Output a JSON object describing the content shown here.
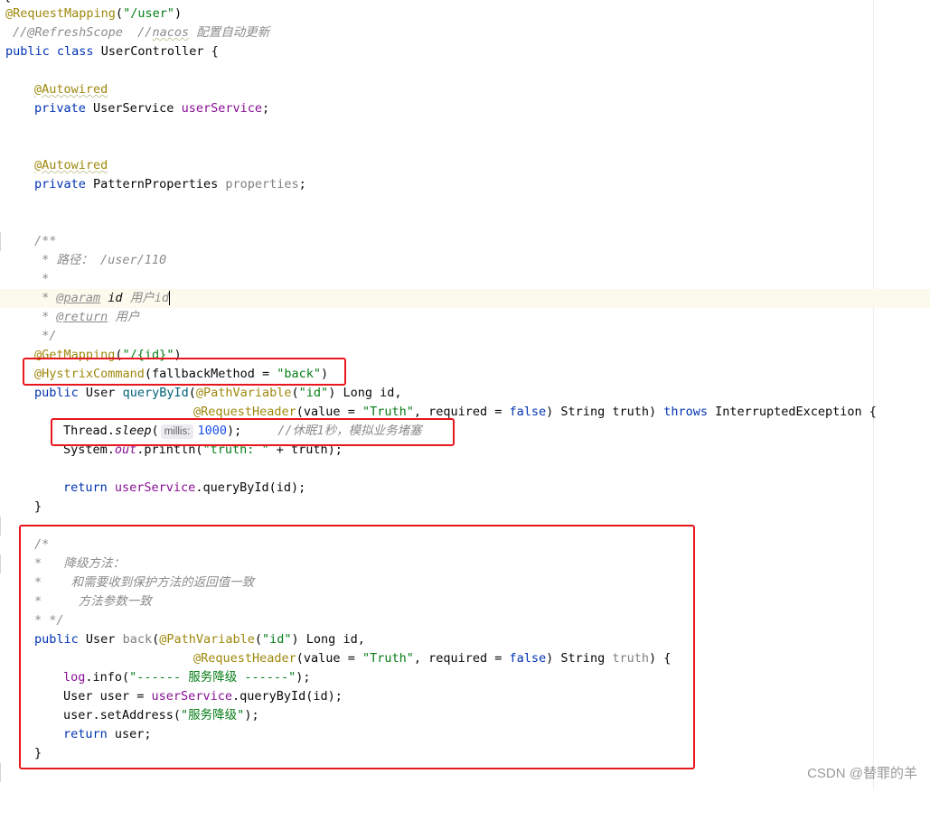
{
  "editor": {
    "top_fragment": "{",
    "lines": {
      "l1": {
        "ann": "@RequestMapping",
        "open": "(",
        "str": "\"/user\"",
        "close": ")"
      },
      "l2": {
        "c1": "//@RefreshScope",
        "c2": "  //",
        "c3": "nacos",
        "c4": " 配置自动更新"
      },
      "l3": {
        "k1": "public",
        "k2": "class",
        "name": "UserController",
        "brace": " {"
      },
      "l5": {
        "ann": "@Autowired"
      },
      "l6": {
        "k": "private",
        "type": " UserService ",
        "field": "userService",
        "end": ";"
      },
      "l9": {
        "ann": "@Autowired"
      },
      "l10": {
        "k": "private",
        "type": " PatternProperties ",
        "field": "properties",
        "end": ";"
      },
      "l13": {
        "text": "/**"
      },
      "l14": {
        "text": " * 路径： /user/110"
      },
      "l15": {
        "text": " *"
      },
      "l16": {
        "pre": " * ",
        "tag": "@param",
        "mid": " id",
        "desc": " 用户id"
      },
      "l17": {
        "pre": " * ",
        "tag": "@return",
        "desc": " 用户"
      },
      "l18": {
        "text": " */"
      },
      "l19": {
        "ann": "@GetMapping",
        "open": "(",
        "str": "\"/{id}\"",
        "close": ")"
      },
      "l20": {
        "ann": "@HystrixCommand",
        "open": "(fallbackMethod = ",
        "str": "\"back\"",
        "close": ")"
      },
      "l21": {
        "k": "public",
        "type": " User ",
        "fn": "queryById",
        "open": "(",
        "ann": "@PathVariable",
        "p1": "(",
        "str": "\"id\"",
        "p2": ") Long id,"
      },
      "l22": {
        "ann": "@RequestHeader",
        "p1": "(value = ",
        "str": "\"Truth\"",
        "p2": ", required = ",
        "k": "false",
        "p3": ") String truth) ",
        "k2": "throws",
        "p4": " InterruptedException {"
      },
      "l23": {
        "cls": "Thread.",
        "m": "sleep",
        "open": "(",
        "hint": "millis:",
        "num": "1000",
        "close": ");",
        "cmt": "//休眠1秒，模拟业务堵塞"
      },
      "l24": {
        "a": "System.",
        "f": "out",
        "b": ".println(",
        "str": "\"truth: \"",
        "c": " + truth);"
      },
      "l26": {
        "k": "return",
        "field": " userService",
        "rest": ".queryById(id);"
      },
      "l27": {
        "text": "}"
      },
      "l29": {
        "text": "/*"
      },
      "l30": {
        "text": "*   降级方法："
      },
      "l31": {
        "text": "*    和需要收到保护方法的返回值一致"
      },
      "l32": {
        "text": "*     方法参数一致"
      },
      "l33": {
        "text": "* */"
      },
      "l34": {
        "k": "public",
        "type": " User ",
        "name": "back",
        "open": "(",
        "ann": "@PathVariable",
        "p1": "(",
        "str": "\"id\"",
        "p2": ") Long id,"
      },
      "l35": {
        "ann": "@RequestHeader",
        "p1": "(value = ",
        "str": "\"Truth\"",
        "p2": ", required = ",
        "k": "false",
        "p3": ") String ",
        "unused": "truth",
        "p4": ") {"
      },
      "l36": {
        "field": "log",
        "a": ".info(",
        "str": "\"------ 服务降级 ------\"",
        "b": ");"
      },
      "l37": {
        "a": "User user = ",
        "field": "userService",
        "b": ".queryById(id);"
      },
      "l38": {
        "a": "user.setAddress(",
        "str": "\"服务降级\"",
        "b": ");"
      },
      "l39": {
        "k": "return",
        "b": " user;"
      },
      "l40": {
        "text": "}"
      }
    }
  },
  "watermark": "CSDN @替罪的羊",
  "colors": {
    "keyword": "#0033b3",
    "annotation": "#9e880d",
    "string": "#067d17",
    "comment": "#8c8c8c",
    "field": "#871094",
    "highlight_box": "#e8161d"
  }
}
